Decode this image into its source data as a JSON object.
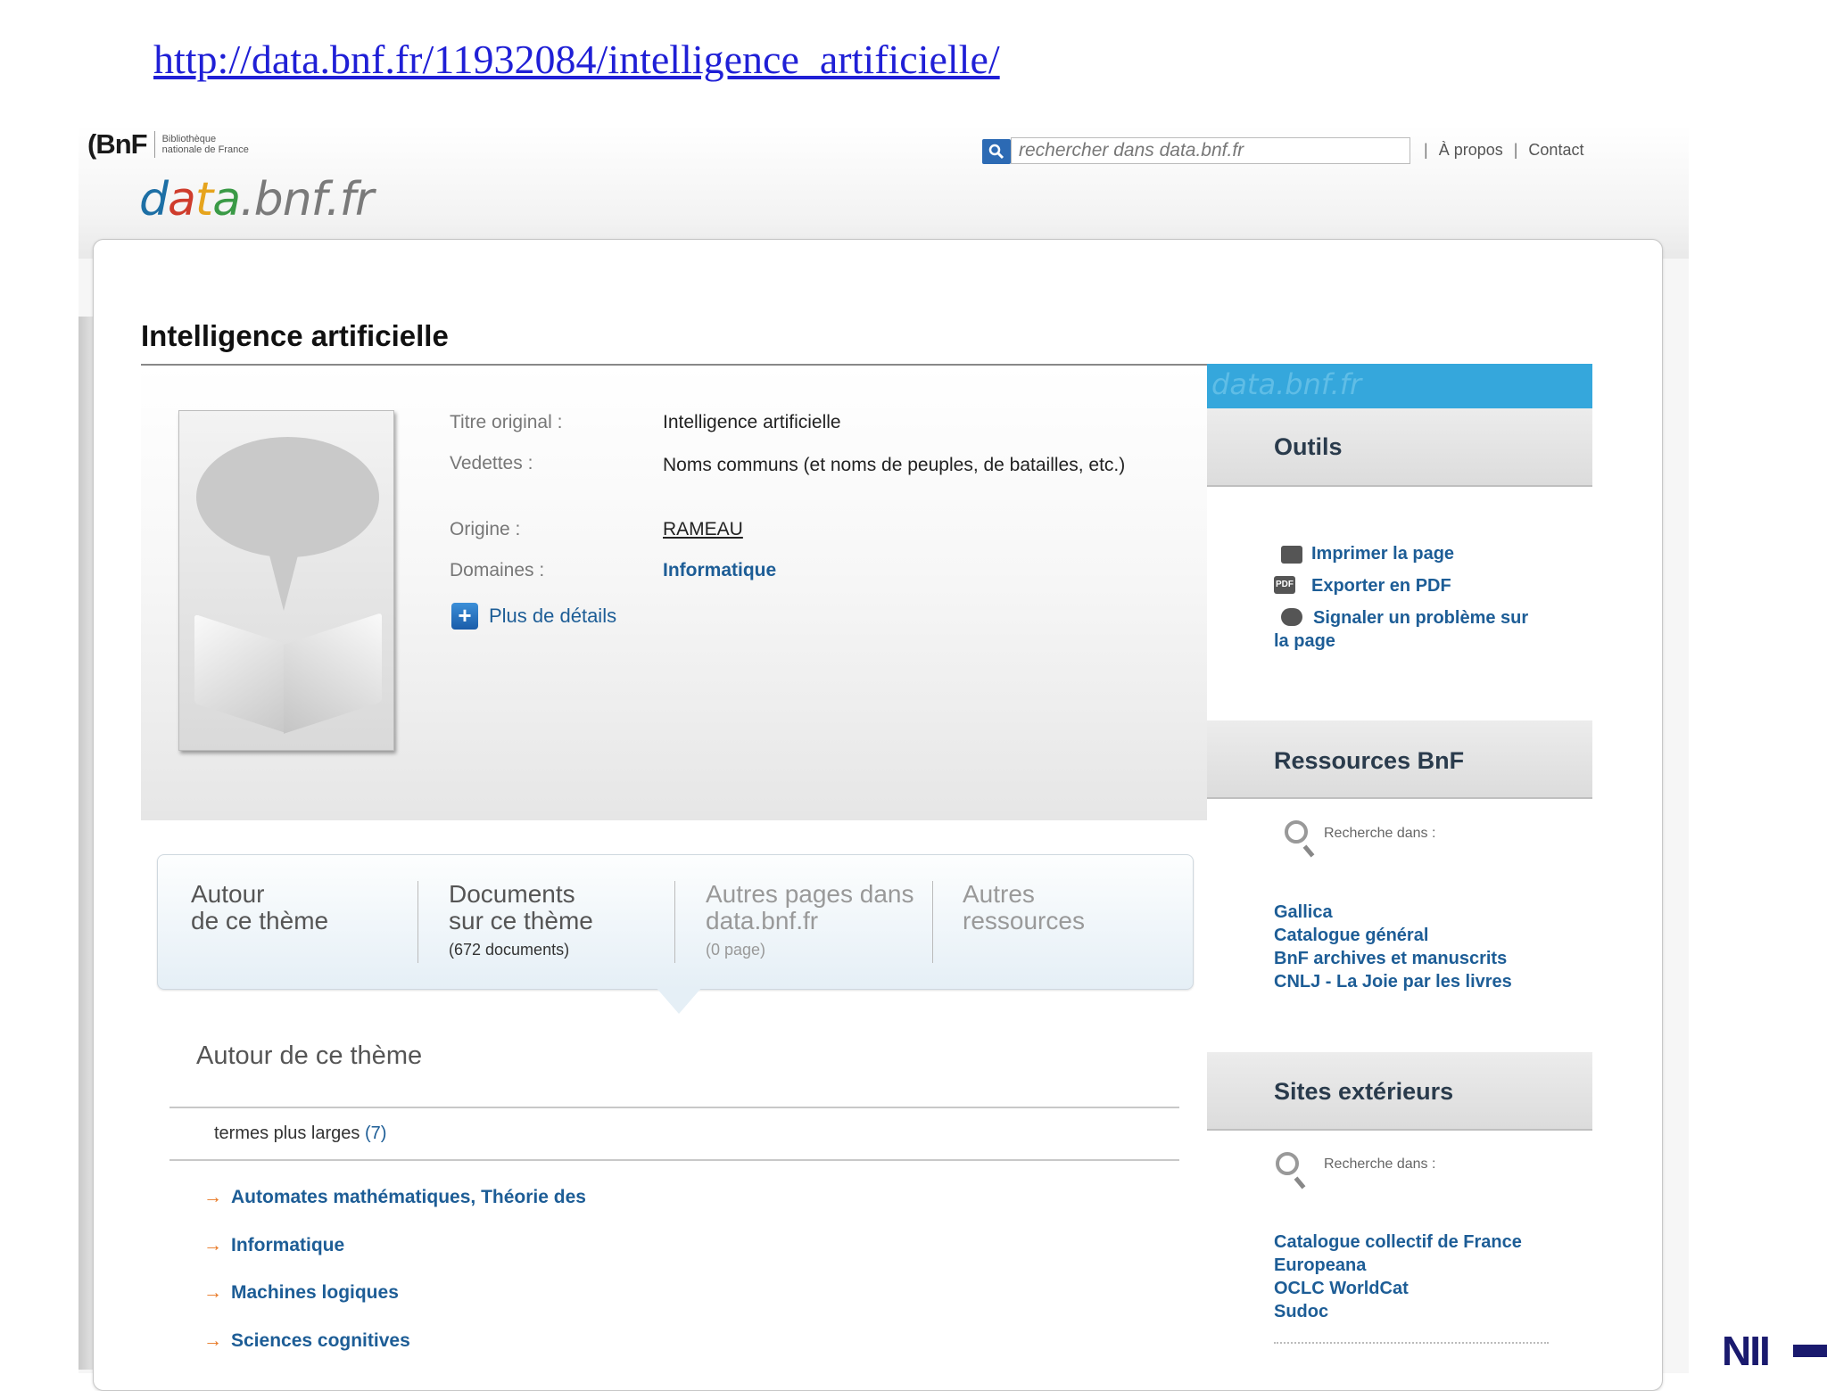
{
  "slide_url": "http://data.bnf.fr/11932084/intelligence_artificielle/",
  "header": {
    "bnf_mark": "(BnF",
    "bnf_text_line1": "Bibliothèque",
    "bnf_text_line2": "nationale de France",
    "data_logo": {
      "p1": "d",
      "p2": "a",
      "p3": "t",
      "p4": "a",
      "rest": ".bnf.fr"
    },
    "search_placeholder": "rechercher dans data.bnf.fr",
    "links": {
      "sep": "|",
      "about": "À propos",
      "contact": "Contact"
    }
  },
  "page": {
    "title": "Intelligence artificielle",
    "info": {
      "titre_label": "Titre original :",
      "titre_value": "Intelligence artificielle",
      "vedettes_label": "Vedettes :",
      "vedettes_value": "Noms communs (et noms de peuples, de batailles, etc.)",
      "origine_label": "Origine :",
      "origine_value": "RAMEAU",
      "domaines_label": "Domaines :",
      "domaines_value": "Informatique",
      "details_link": "Plus de détails",
      "details_icon": "+"
    },
    "tabs": {
      "tab1_line1": "Autour",
      "tab1_line2": "de ce thème",
      "tab2_line1": "Documents",
      "tab2_line2": "sur ce thème",
      "tab2_sub": "(672 documents)",
      "tab3_line1": "Autres pages dans",
      "tab3_line2": "data.bnf.fr",
      "tab3_sub": "(0 page)",
      "tab4_line1": "Autres",
      "tab4_line2": "ressources"
    },
    "section_title": "Autour de ce thème",
    "broader_label": "termes plus larges",
    "broader_count": "(7)",
    "arrow": "→",
    "terms": [
      "Automates mathématiques, Théorie des",
      "Informatique",
      "Machines logiques",
      "Sciences cognitives"
    ]
  },
  "sidebar": {
    "banner": "data.bnf.fr",
    "outils_title": "Outils",
    "tools": {
      "print": "Imprimer la page",
      "pdf": "Exporter en PDF",
      "report_line1": "Signaler un problème sur",
      "report_line2": "la page"
    },
    "tool_icons": {
      "print": "printer-icon",
      "pdf": "pdf-icon",
      "report": "comment-icon"
    },
    "pdf_icon_text": "PDF",
    "ressources_title": "Ressources BnF",
    "search_in": "Recherche dans :",
    "ressources_links": [
      "Gallica",
      "Catalogue général",
      "BnF archives et manuscrits",
      "CNLJ - La Joie par les livres"
    ],
    "sites_title": "Sites extérieurs",
    "sites_links": [
      "Catalogue collectif de France",
      "Europeana",
      "OCLC WorldCat",
      "Sudoc"
    ]
  },
  "badge": {
    "nii": "NII"
  },
  "colors": {
    "link": "#1d5d96",
    "banner": "#35a7dc",
    "arrow": "#e87722",
    "slide_url": "#1f1fd6"
  }
}
